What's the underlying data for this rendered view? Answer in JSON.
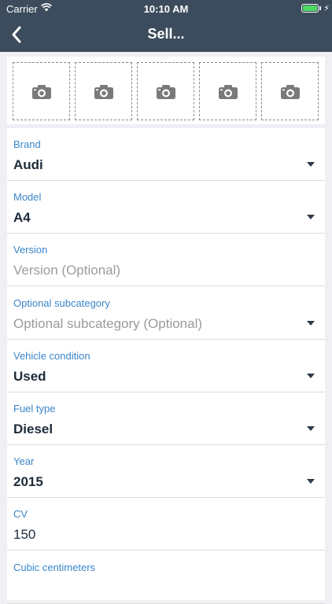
{
  "status_bar": {
    "carrier": "Carrier",
    "time": "10:10 AM",
    "battery_level": 1.0,
    "battery_color": "#4cd964"
  },
  "nav": {
    "title": "Sell...",
    "back_icon": "chevron-left-icon",
    "background": "#3c4c5d"
  },
  "photos": {
    "slots": [
      {
        "icon": "camera-icon"
      },
      {
        "icon": "camera-icon"
      },
      {
        "icon": "camera-icon"
      },
      {
        "icon": "camera-icon"
      },
      {
        "icon": "camera-icon"
      }
    ]
  },
  "form": {
    "fields": [
      {
        "label": "Brand",
        "value": "Audi",
        "dropdown": true
      },
      {
        "label": "Model",
        "value": "A4",
        "dropdown": true
      },
      {
        "label": "Version",
        "placeholder": "Version (Optional)",
        "dropdown": false
      },
      {
        "label": "Optional subcategory",
        "placeholder": "Optional subcategory (Optional)",
        "dropdown": true
      },
      {
        "label": "Vehicle condition",
        "value": "Used",
        "dropdown": true
      },
      {
        "label": "Fuel type",
        "value": "Diesel",
        "dropdown": true
      },
      {
        "label": "Year",
        "value": "2015",
        "dropdown": true
      },
      {
        "label": "CV",
        "value": "150",
        "dropdown": false
      },
      {
        "label": "Cubic centimeters",
        "value": "",
        "dropdown": false
      }
    ]
  },
  "colors": {
    "label": "#3a86c8",
    "value": "#1d2b3a",
    "placeholder": "#9b9b9b"
  }
}
